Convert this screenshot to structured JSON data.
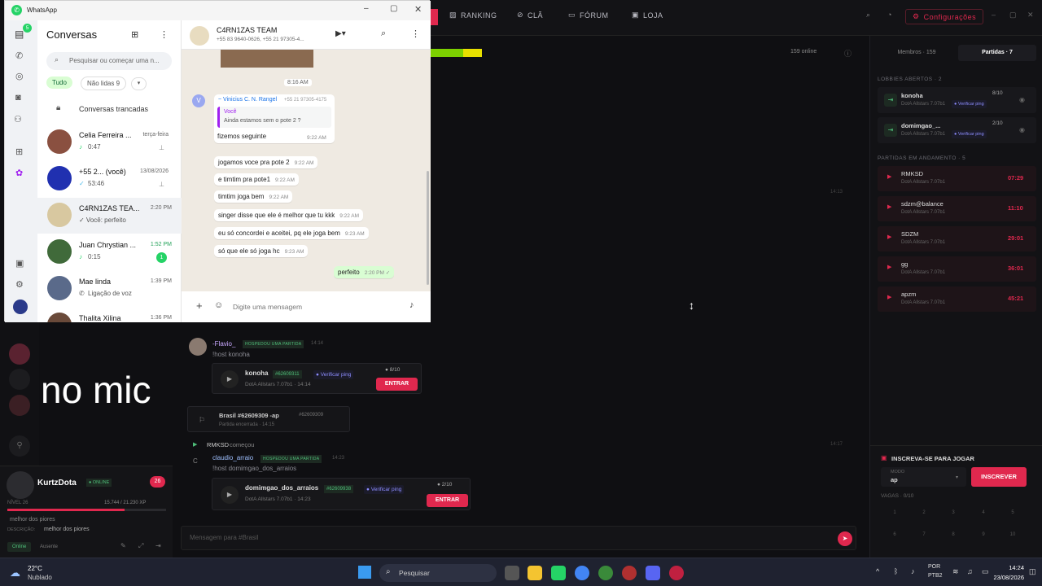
{
  "game": {
    "nav": {
      "ranking": "RANKING",
      "cla": "CLÃ",
      "forum": "FÓRUM",
      "loja": "LOJA",
      "config": "Configurações"
    },
    "online_count": "159 online",
    "tabs": {
      "members": "Membros · 159",
      "matches": "Partidas · 7"
    },
    "overlay_text": "no mic",
    "profile": {
      "name": "KurtzDota",
      "status_badge": "● ONLINE",
      "level": "NÍVEL 26",
      "xp": "15.744 / 21.230 XP",
      "bio": "melhor dos piores",
      "desc_label": "DESCRIÇÃO:",
      "desc": "melhor dos piores",
      "btn_online": "Online",
      "btn_away": "Ausente",
      "notif": "26"
    },
    "lobbies_title": "LOBBIES ABERTOS · 2",
    "lobbies": [
      {
        "name": "konoha",
        "sub": "DotA Allstars 7.07b1",
        "slots": "8/10",
        "ping": "● Verificar ping"
      },
      {
        "name": "domimgao_...",
        "sub": "DotA Allstars 7.07b1",
        "slots": "2/10",
        "ping": "● Verificar ping"
      }
    ],
    "matches_title": "PARTIDAS EM ANDAMENTO · 5",
    "matches": [
      {
        "name": "RMKSD",
        "sub": "DotA Allstars 7.07b1",
        "time": "07:29"
      },
      {
        "name": "sdzm@balance",
        "sub": "DotA Allstars 7.07b1",
        "time": "11:10"
      },
      {
        "name": "SDZM",
        "sub": "DotA Allstars 7.07b1",
        "time": "29:01"
      },
      {
        "name": "gg",
        "sub": "DotA Allstars 7.07b1",
        "time": "36:01"
      },
      {
        "name": "apzm",
        "sub": "DotA Allstars 7.07b1",
        "time": "45:21"
      }
    ],
    "signup": {
      "title": "INSCREVA-SE PARA JOGAR",
      "mode_label": "MODO",
      "mode_value": "ap",
      "button": "INSCREVER",
      "slots": "VAGAS · 0/10",
      "nums": [
        "1",
        "2",
        "3",
        "4",
        "5",
        "6",
        "7",
        "8",
        "9",
        "10"
      ]
    },
    "chat": {
      "time1": "14:13",
      "msg1_user": "-Flavio_",
      "msg1_badge": "HOSPEDOU UMA PARTIDA",
      "msg1_time": "14:14",
      "msg1_cmd": "!host konoha",
      "card1": {
        "name": "konoha",
        "hash": "#62609311",
        "ping": "● Verificar ping",
        "slots": "● 8/10",
        "sub": "DotA Allstars 7.07b1 · 14:14",
        "btn": "ENTRAR"
      },
      "ended": {
        "title": "Brasil #62609309 -ap",
        "hash": "#62609309",
        "sub": "Partida encerrada · 14:15"
      },
      "started": {
        "name": "RMKSD",
        "text": "começou",
        "time": "14:17"
      },
      "msg2_user": "claudio_arraio",
      "msg2_badge": "HOSPEDOU UMA PARTIDA",
      "msg2_time": "14:23",
      "msg2_cmd": "!host domimgao_dos_arraios",
      "card2": {
        "name": "domimgao_dos_arraios",
        "hash": "#62609938",
        "ping": "● Verificar ping",
        "slots": "● 2/10",
        "sub": "DotA Allstars 7.07b1 · 14:23",
        "btn": "ENTRAR"
      },
      "input_placeholder": "Mensagem para #Brasil"
    },
    "colors": {
      "accent": "#e0284e",
      "green": "#4fbf7a",
      "ping": "#8d8dff"
    }
  },
  "whatsapp": {
    "title": "WhatsApp",
    "list_title": "Conversas",
    "search_placeholder": "Pesquisar ou começar uma n...",
    "filters": {
      "all": "Tudo",
      "unread": "Não lidas 9"
    },
    "locked": "Conversas trancadas",
    "rail_badge": "5",
    "chats": [
      {
        "name": "Celia Ferreira ...",
        "time": "terça-feira",
        "preview": "0:47"
      },
      {
        "name": "+55 2... (você)",
        "time": "13/08/2026",
        "preview": "53:46"
      },
      {
        "name": "C4RN1ZAS TEA...",
        "time": "2:20 PM",
        "preview": "✓ Você: perfeito"
      },
      {
        "name": "Juan Chrystian ...",
        "time": "1:52 PM",
        "preview": "0:15",
        "unread": "1"
      },
      {
        "name": "Mae linda",
        "time": "1:39 PM",
        "preview": "Ligação de voz"
      },
      {
        "name": "Thalita Xilina",
        "time": "1:36 PM",
        "preview": ""
      }
    ],
    "header": {
      "name": "C4RN1ZAS TEAM",
      "members": "+55 83 9640-0626, +55 21 97305-4..."
    },
    "day_time": "8:16 AM",
    "quote": {
      "sender": "~ Vinicius C. N. Rangel",
      "sender_phone": "+55 21 97305-4175",
      "quoted_author": "Você",
      "quoted_text": "Ainda estamos sem o pote 2 ?"
    },
    "messages": [
      {
        "text": "fizemos seguinte",
        "time": "9:22 AM"
      },
      {
        "text": "jogamos voce pra pote 2",
        "time": "9:22 AM"
      },
      {
        "text": "e timtim pra pote1",
        "time": "9:22 AM"
      },
      {
        "text": "timtim joga bem",
        "time": "9:22 AM"
      },
      {
        "text": "singer disse que ele é melhor que tu kkk",
        "time": "9:22 AM"
      },
      {
        "text": "eu só concordei e aceitei, pq ele joga bem",
        "time": "9:23 AM"
      },
      {
        "text": "só que ele só joga hc",
        "time": "9:23 AM"
      }
    ],
    "outgoing": {
      "text": "perfeito",
      "time": "2:20 PM ✓"
    },
    "input_placeholder": "Digite uma mensagem",
    "accent": "#25d366"
  },
  "taskbar": {
    "weather_temp": "22°C",
    "weather_desc": "Nublado",
    "search": "Pesquisar",
    "lang1": "POR",
    "lang2": "PTB2",
    "time": "14:24",
    "date": "23/08/2026"
  }
}
